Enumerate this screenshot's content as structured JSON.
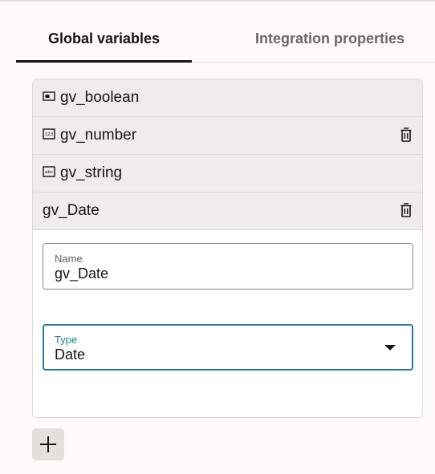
{
  "tabs": [
    {
      "label": "Global variables",
      "selected": true
    },
    {
      "label": "Integration properties",
      "selected": false
    }
  ],
  "variables": [
    {
      "name": "gv_boolean",
      "icon": "boolean-type-icon",
      "deletable": false
    },
    {
      "name": "gv_number",
      "icon": "number-type-icon",
      "deletable": true
    },
    {
      "name": "gv_string",
      "icon": "string-type-icon",
      "deletable": false
    },
    {
      "name": "gv_Date",
      "icon": "",
      "deletable": true,
      "expanded": true
    }
  ],
  "editor": {
    "name_label": "Name",
    "name_value": "gv_Date",
    "type_label": "Type",
    "type_value": "Date"
  },
  "colors": {
    "accent": "#227e9e",
    "row_bg": "#efedeb"
  }
}
